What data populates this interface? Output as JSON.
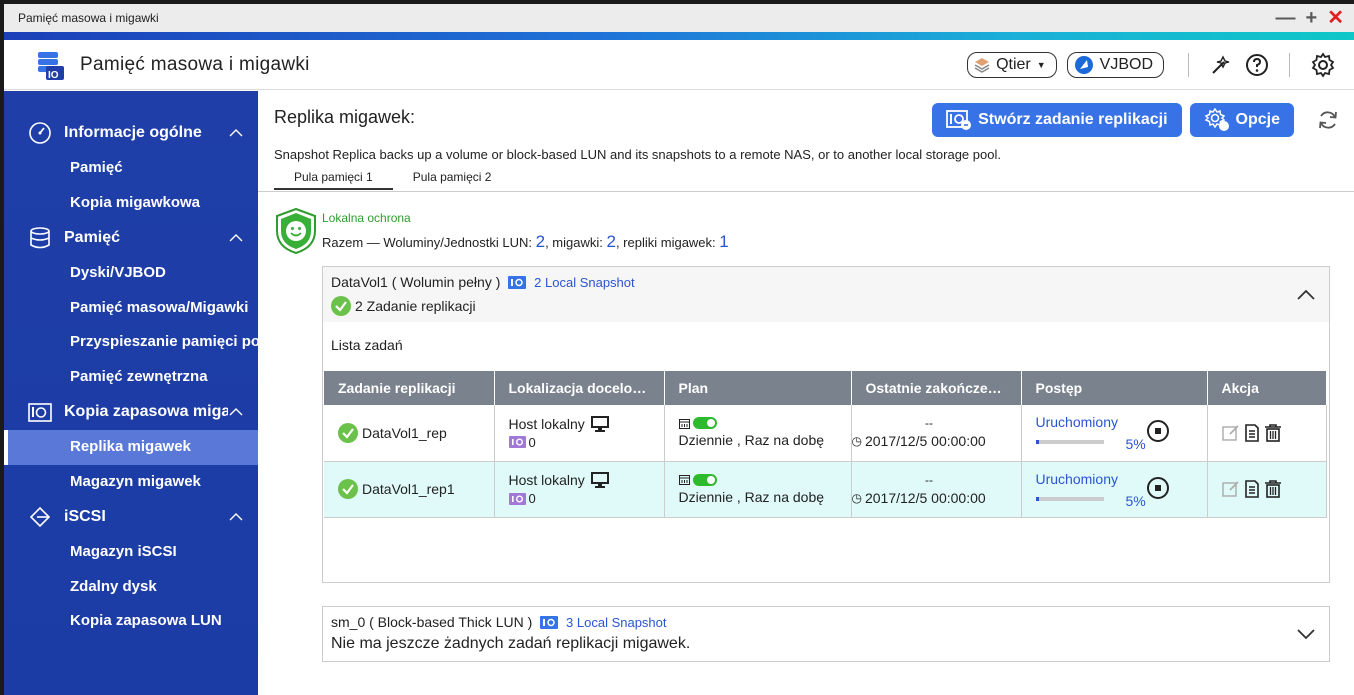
{
  "window": {
    "title": "Pamięć masowa i migawki",
    "min": "—",
    "max": "+",
    "close": "✕"
  },
  "header": {
    "app_title": "Pamięć masowa i migawki",
    "qtier": "Qtier",
    "vjbod": "VJBOD"
  },
  "sidebar": {
    "sections": [
      {
        "label": "Informacje ogólne",
        "icon": "dashboard-icon",
        "items": [
          "Pamięć",
          "Kopia migawkowa"
        ]
      },
      {
        "label": "Pamięć",
        "icon": "storage-icon",
        "items": [
          "Dyski/VJBOD",
          "Pamięć masowa/Migawki",
          "Przyspieszanie pamięci podręcznej",
          "Pamięć zewnętrzna"
        ]
      },
      {
        "label": "Kopia zapasowa migawek",
        "icon": "snapshot-backup-icon",
        "items": [
          "Replika migawek",
          "Magazyn migawek"
        ]
      },
      {
        "label": "iSCSI",
        "icon": "iscsi-icon",
        "items": [
          "Magazyn iSCSI",
          "Zdalny dysk",
          "Kopia zapasowa LUN"
        ]
      }
    ],
    "active_item": "Replika migawek"
  },
  "page": {
    "title": "Replika migawek:",
    "create_button": "Stwórz zadanie replikacji",
    "options_button": "Opcje",
    "description": "Snapshot Replica backs up a volume or block-based LUN and its snapshots to a remote NAS, or to another local storage pool.",
    "tabs": [
      "Pula pamięci  1",
      "Pula pamięci  2"
    ]
  },
  "protection": {
    "title": "Lokalna ochrona",
    "summary_prefix": "Razem — Woluminy/Jednostki LUN: ",
    "volumes_count": "2",
    "snap_label": ", migawki: ",
    "snap_count": "2",
    "replica_label": ", repliki migawek: ",
    "replica_count": "1"
  },
  "volume1": {
    "name": "DataVol1 ( Wolumin pełny )",
    "snapshots": "2 Local Snapshot",
    "tasks": "2 Zadanie replikacji",
    "list_title": "Lista zadań",
    "columns": [
      "Zadanie replikacji",
      "Lokalizacja docelowa",
      "Plan",
      "Ostatnie zakończenie",
      "Postęp",
      "Akcja"
    ],
    "rows": [
      {
        "name": "DataVol1_rep",
        "location": "Host lokalny",
        "snap_count": "0",
        "plan": "Dziennie , Raz na dobę",
        "last_top": "--",
        "last_time": "2017/12/5 00:00:00",
        "status": "Uruchomiony",
        "progress": "5%"
      },
      {
        "name": "DataVol1_rep1",
        "location": "Host lokalny",
        "snap_count": "0",
        "plan": "Dziennie , Raz na dobę",
        "last_top": "--",
        "last_time": "2017/12/5 00:00:00",
        "status": "Uruchomiony",
        "progress": "5%"
      }
    ]
  },
  "volume2": {
    "name": "sm_0 ( Block-based Thick LUN )",
    "snapshots": "3 Local Snapshot",
    "message": "Nie ma jeszcze żadnych zadań replikacji migawek."
  },
  "colors": {
    "accent_blue": "#3772e6",
    "sidebar": "#1f3ea8",
    "success": "#2dba2d",
    "link": "#2a55d0"
  }
}
